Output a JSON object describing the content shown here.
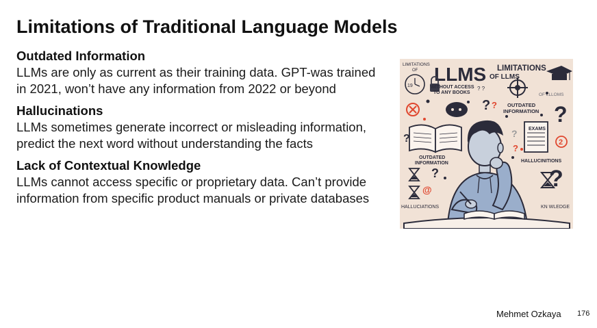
{
  "slide": {
    "title": "Limitations of Traditional Language Models",
    "sections": [
      {
        "heading": "Outdated Information",
        "body": "LLMs are only as current as their training data. GPT-was trained in 2021, won’t have any information from 2022 or beyond"
      },
      {
        "heading": "Hallucinations",
        "body": "LLMs sometimes generate incorrect or misleading information, predict the next word without understanding the facts"
      },
      {
        "heading": "Lack of Contextual Knowledge",
        "body": "LLMs cannot access specific or proprietary data. Can’t provide information from specific product manuals or private databases"
      }
    ],
    "illustration": {
      "big_title": "LLMS",
      "title_right": "LIMITATIONS",
      "title_right_sub": "OF LLMS",
      "left_top": "LIMITATIONS",
      "left_top_sub": "OF",
      "no_access_1": "WITHOUT ACCESS",
      "no_access_2": "TO ANY BOOKS",
      "of_llms_small": "OF LLLOMS",
      "outdated_right_1": "OUTDATED",
      "outdated_right_2": "INFORMATION",
      "exams": "EXAMS",
      "outdated_left_1": "OUTDATED",
      "outdated_left_2": "INFORMATION",
      "hallucinations_right": "HALLUCINITIONS",
      "hallucinations_left": "HALLUCIATIONS",
      "knowledge": "KN WLEDGE",
      "counter": "19"
    },
    "footer": {
      "author": "Mehmet Ozkaya",
      "page_number": "176"
    },
    "colors": {
      "illustration_bg": "#f1e2d6",
      "accent_red": "#e0472f",
      "ink": "#2b2b3a",
      "shirt_blue": "#9aaecb"
    }
  }
}
